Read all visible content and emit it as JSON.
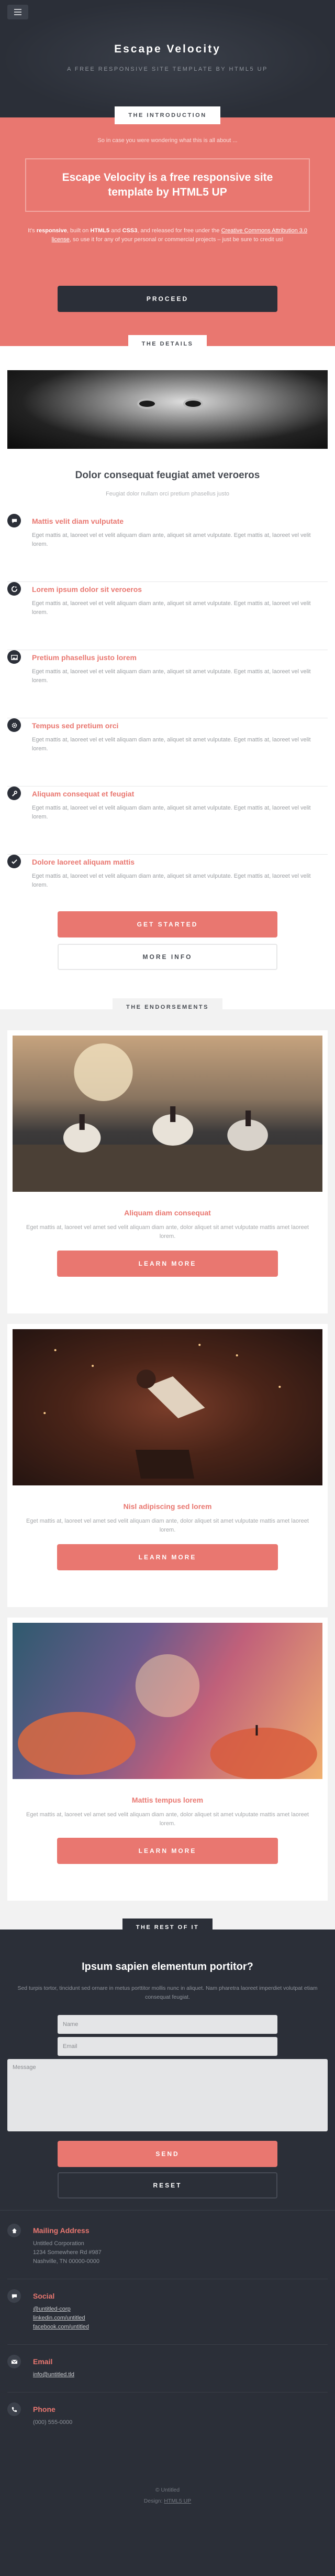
{
  "header": {
    "menu_icon": "hamburger-icon",
    "title": "Escape Velocity",
    "tagline": "A FREE RESPONSIVE SITE TEMPLATE BY HTML5 UP"
  },
  "intro": {
    "label": "THE INTRODUCTION",
    "question": "So in case you were wondering what this is all about ...",
    "headline": "Escape Velocity is a free responsive site template by HTML5 UP",
    "text_prefix": "It's ",
    "responsive": "responsive",
    "text_mid1": ", built on ",
    "html5": "HTML5",
    "text_and": " and ",
    "css3": "CSS3",
    "text_mid2": ", and released for free under the ",
    "license": "Creative Commons Attribution 3.0 license",
    "text_suffix": ", so use it for any of your personal or commercial projects – just be sure to credit us!",
    "proceed_label": "PROCEED"
  },
  "details": {
    "label": "THE DETAILS",
    "title": "Dolor consequat feugiat amet veroeros",
    "subtitle": "Feugiat dolor nullam orci pretium phasellus justo",
    "features": [
      {
        "icon": "chat-bubble-icon",
        "title": "Mattis velit diam vulputate",
        "text": "Eget mattis at, laoreet vel et velit aliquam diam ante, aliquet sit amet vulputate. Eget mattis at, laoreet vel velit lorem."
      },
      {
        "icon": "refresh-icon",
        "title": "Lorem ipsum dolor sit veroeros",
        "text": "Eget mattis at, laoreet vel et velit aliquam diam ante, aliquet sit amet vulputate. Eget mattis at, laoreet vel velit lorem."
      },
      {
        "icon": "image-icon",
        "title": "Pretium phasellus justo lorem",
        "text": "Eget mattis at, laoreet vel et velit aliquam diam ante, aliquet sit amet vulputate. Eget mattis at, laoreet vel velit lorem."
      },
      {
        "icon": "gear-icon",
        "title": "Tempus sed pretium orci",
        "text": "Eget mattis at, laoreet vel et velit aliquam diam ante, aliquet sit amet vulputate. Eget mattis at, laoreet vel velit lorem."
      },
      {
        "icon": "wrench-icon",
        "title": "Aliquam consequat et feugiat",
        "text": "Eget mattis at, laoreet vel et velit aliquam diam ante, aliquet sit amet vulputate. Eget mattis at, laoreet vel velit lorem."
      },
      {
        "icon": "check-icon",
        "title": "Dolore laoreet aliquam mattis",
        "text": "Eget mattis at, laoreet vel et velit aliquam diam ante, aliquet sit amet vulputate. Eget mattis at, laoreet vel velit lorem."
      }
    ],
    "get_started_label": "GET STARTED",
    "more_info_label": "MORE INFO"
  },
  "endorsements": {
    "label": "THE ENDORSEMENTS",
    "cards": [
      {
        "title": "Aliquam diam consequat",
        "text": "Eget mattis at, laoreet vel amet sed velit aliquam diam ante, dolor aliquet sit amet vulputate mattis amet laoreet lorem.",
        "button": "LEARN MORE"
      },
      {
        "title": "Nisl adipiscing sed lorem",
        "text": "Eget mattis at, laoreet vel amet sed velit aliquam diam ante, dolor aliquet sit amet vulputate mattis amet laoreet lorem.",
        "button": "LEARN MORE"
      },
      {
        "title": "Mattis tempus lorem",
        "text": "Eget mattis at, laoreet vel amet sed velit aliquam diam ante, dolor aliquet sit amet vulputate mattis amet laoreet lorem.",
        "button": "LEARN MORE"
      }
    ]
  },
  "contact": {
    "label": "THE REST OF IT",
    "title": "Ipsum sapien elementum portitor?",
    "text": "Sed turpis tortor, tincidunt sed ornare in metus porttitor mollis nunc in aliquet. Nam pharetra laoreet imperdiet volutpat etiam consequat feugiat.",
    "name_placeholder": "Name",
    "email_placeholder": "Email",
    "message_placeholder": "Message",
    "send_label": "SEND",
    "reset_label": "RESET",
    "mailing": {
      "icon": "home-icon",
      "title": "Mailing Address",
      "line1": "Untitled Corporation",
      "line2": "1234 Somewhere Rd #987",
      "line3": "Nashville, TN 00000-0000"
    },
    "social": {
      "icon": "comment-icon",
      "title": "Social",
      "line1": "@untitled-corp",
      "line2": "linkedin.com/untitled",
      "line3": "facebook.com/untitled"
    },
    "email": {
      "icon": "envelope-icon",
      "title": "Email",
      "line1": "info@untitled.tld"
    },
    "phone": {
      "icon": "phone-icon",
      "title": "Phone",
      "line1": "(000) 555-0000"
    }
  },
  "footer": {
    "copyright": "© Untitled",
    "design": "Design: ",
    "design_link": "HTML5 UP"
  }
}
